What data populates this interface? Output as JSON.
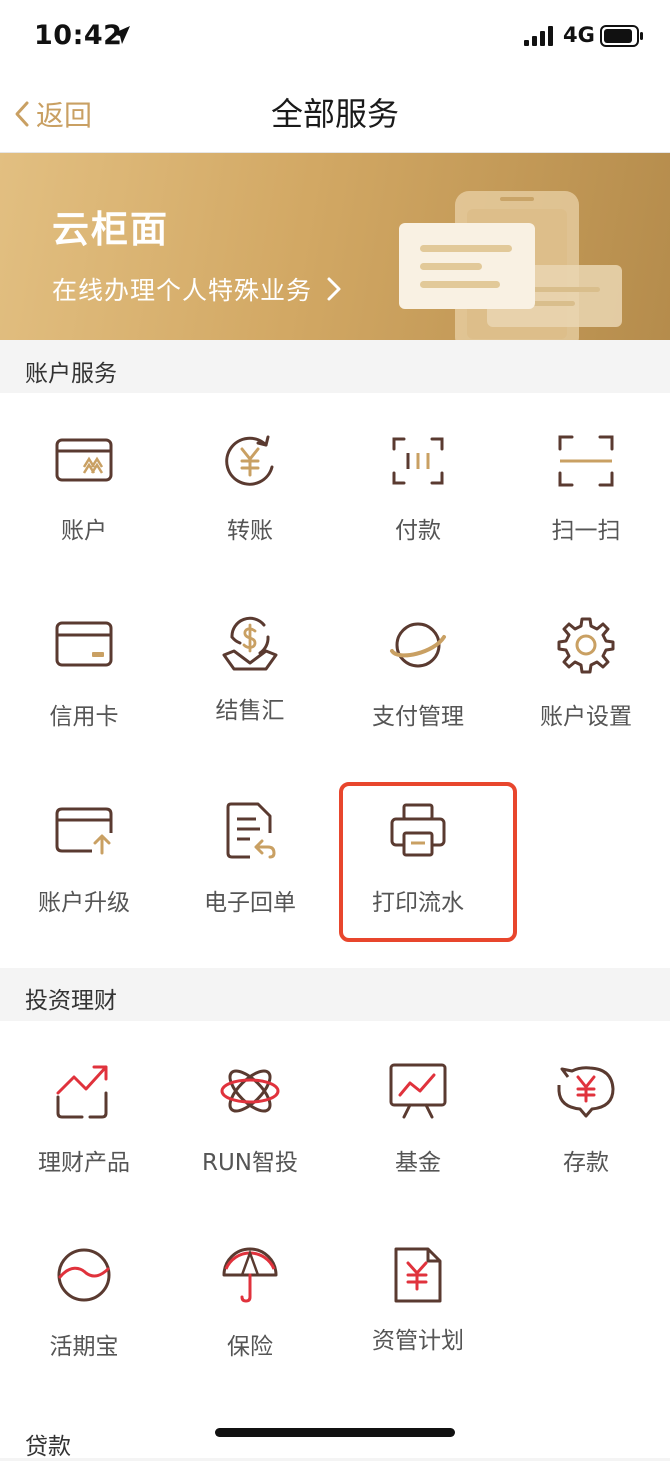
{
  "status": {
    "time": "10:42",
    "network": "4G",
    "icons": [
      "location-arrow-icon",
      "signal-bars-icon",
      "battery-icon"
    ]
  },
  "nav": {
    "back_label": "返回",
    "title": "全部服务"
  },
  "banner": {
    "title": "云柜面",
    "subtitle": "在线办理个人特殊业务"
  },
  "sections": [
    {
      "title": "账户服务",
      "items": [
        {
          "label": "账户",
          "icon": "account-card-icon"
        },
        {
          "label": "转账",
          "icon": "transfer-yuan-icon"
        },
        {
          "label": "付款",
          "icon": "pay-code-icon"
        },
        {
          "label": "扫一扫",
          "icon": "scan-icon"
        },
        {
          "label": "信用卡",
          "icon": "credit-card-icon"
        },
        {
          "label": "结售汇",
          "icon": "fx-exchange-icon"
        },
        {
          "label": "支付管理",
          "icon": "payment-planet-icon"
        },
        {
          "label": "账户设置",
          "icon": "gear-icon"
        },
        {
          "label": "账户升级",
          "icon": "account-upgrade-icon"
        },
        {
          "label": "电子回单",
          "icon": "e-receipt-icon"
        },
        {
          "label": "打印流水",
          "icon": "printer-icon"
        }
      ]
    },
    {
      "title": "投资理财",
      "items": [
        {
          "label": "理财产品",
          "icon": "trend-up-icon"
        },
        {
          "label": "RUN智投",
          "icon": "atom-icon"
        },
        {
          "label": "基金",
          "icon": "fund-board-icon"
        },
        {
          "label": "存款",
          "icon": "piggy-yuan-icon"
        },
        {
          "label": "活期宝",
          "icon": "wave-circle-icon"
        },
        {
          "label": "保险",
          "icon": "umbrella-icon"
        },
        {
          "label": "资管计划",
          "icon": "asset-plan-icon"
        }
      ]
    },
    {
      "title": "贷款"
    }
  ],
  "colors": {
    "gold": "#c9a063",
    "brown": "#5a3a30",
    "red": "#e0323c",
    "highlight": "#e8462d"
  }
}
